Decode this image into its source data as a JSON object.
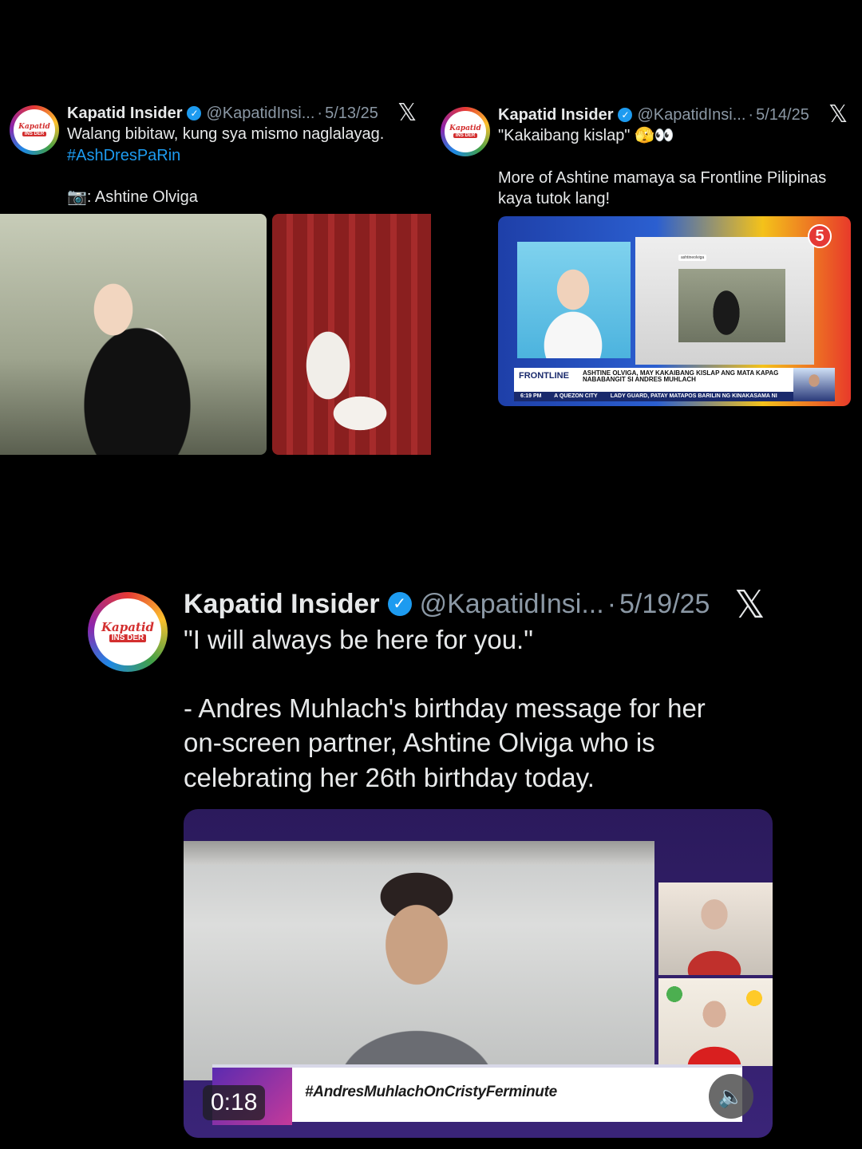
{
  "tweets": [
    {
      "author": "Kapatid Insider",
      "handle": "@KapatidInsi...",
      "separator": "·",
      "date": "5/13/25",
      "text_line1": "Walang bibitaw, kung sya mismo naglalayag.",
      "hashtag": "#AshDresPaRin",
      "credit": "📷: Ashtine Olviga"
    },
    {
      "author": "Kapatid Insider",
      "handle": "@KapatidInsi...",
      "separator": "·",
      "date": "5/14/25",
      "text_line1": "\"Kakaibang kislap\" 🫣👀",
      "text_line2": "More of Ashtine mamaya sa Frontline Pilipinas",
      "text_line3": "kaya tutok lang!",
      "media": {
        "channel": "5",
        "show": "FRONTLINE",
        "headline": "ASHTINE OLVIGA, MAY KAKAIBANG KISLAP ANG MATA KAPAG NABABANGIT SI ANDRES MUHLACH",
        "time": "6:19 PM",
        "ticker1": "A QUEZON CITY",
        "ticker2": "LADY GUARD, PATAY MATAPOS BARILIN NG KINAKASAMA NI",
        "insta_handle": "ashtineolviga"
      }
    },
    {
      "author": "Kapatid Insider",
      "handle": "@KapatidInsi...",
      "separator": "·",
      "date": "5/19/25",
      "quote": "\"I will always be here for you.\"",
      "body_line1": "- Andres Muhlach's birthday message for her",
      "body_line2": "on-screen partner, Ashtine Olviga who is",
      "body_line3": "celebrating her 26th birthday today.",
      "video": {
        "hashtag": "#AndresMuhlachOnCristyFerminute",
        "timestamp": "0:18"
      }
    }
  ],
  "avatar": {
    "top": "Kapatid",
    "bottom": "INS DER"
  },
  "icons": {
    "verified": "✓",
    "x_logo": "𝕏",
    "speaker": "🔈"
  },
  "colors": {
    "background": "#000000",
    "link": "#1d9bf0",
    "verified": "#1d9bf0",
    "muted": "#8b98a5"
  }
}
